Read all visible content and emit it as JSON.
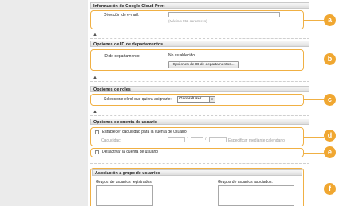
{
  "gcp": {
    "header": "Información de Google Cloud Print",
    "email_label": "Dirección de e-mail:",
    "email_value": "",
    "email_hint": "(Máximo 256 caracteres)"
  },
  "dept": {
    "header": "Opciones de ID de departamentos",
    "id_label": "ID de departamento:",
    "id_value": "No establecido.",
    "button": "Opciones de ID de departamentos..."
  },
  "roles": {
    "header": "Opciones de roles",
    "label": "Seleccione el rol que quiera asignarle:",
    "selected": "GeneralUser"
  },
  "account": {
    "header": "Opciones de cuenta de usuario",
    "expiry_checkbox": "Establecer caducidad para la cuenta de usuario",
    "expiry_label": "Caducidad:",
    "calendar_link": "Especificar mediante calendario",
    "deactivate_checkbox": "Desactivar la cuenta de usuario"
  },
  "groups": {
    "header": "Asociación a grupo de usuarios",
    "registered_label": "Grupos de usuarios registrados:",
    "associated_label": "Grupos de usuarios asociados:"
  },
  "callouts": [
    "a",
    "b",
    "c",
    "d",
    "e",
    "f"
  ],
  "colors": {
    "accent": "#f0a731",
    "border": "#f0b044"
  },
  "icons": {
    "up_arrow": "▲",
    "dropdown": "▼"
  }
}
